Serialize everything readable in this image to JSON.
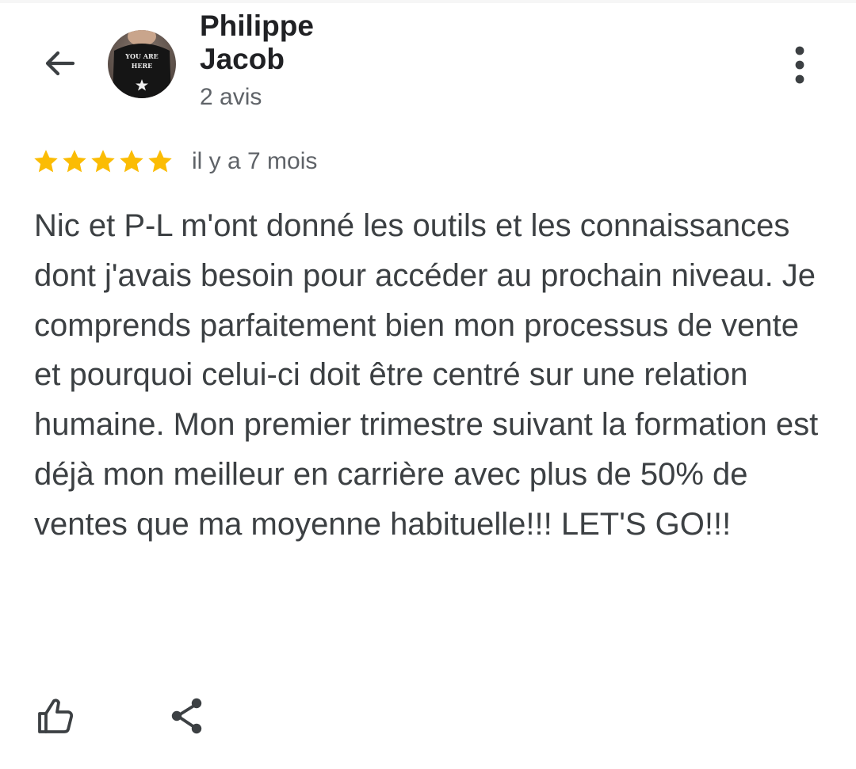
{
  "reviewer": {
    "name": "Philippe Jacob",
    "review_count": "2 avis",
    "avatar": {
      "shirt_text": "YOU ARE HERE"
    }
  },
  "review": {
    "rating": 5,
    "max_rating": 5,
    "time": "il y a 7 mois",
    "text": "Nic et P-L m'ont donné les outils et les connaissances dont j'avais besoin pour accéder au prochain niveau. Je comprends parfaitement bien mon processus de vente et pourquoi celui-ci doit être centré sur une relation humaine. Mon premier trimestre suivant la formation est déjà mon meilleur en carrière avec plus de 50% de ventes que ma moyenne habituelle!!! LET'S GO!!!"
  },
  "icons": {
    "back": "arrow-left-icon",
    "more": "more-vertical-icon",
    "star": "star-icon",
    "like": "thumbs-up-icon",
    "share": "share-icon"
  },
  "colors": {
    "star": "#fbbc04",
    "text": "#3c4043",
    "secondary_text": "#5f6368",
    "icon": "#3c4043"
  }
}
